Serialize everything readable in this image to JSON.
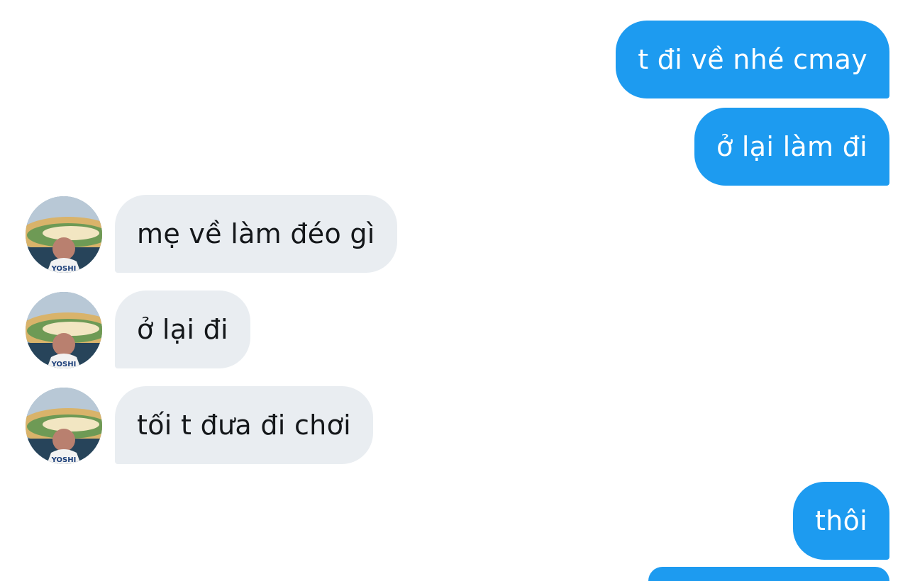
{
  "colors": {
    "outgoing_bubble": "#1d9bf0",
    "incoming_bubble": "#e9edf1",
    "outgoing_text": "#ffffff",
    "incoming_text": "#14171a"
  },
  "avatar": {
    "icon": "user-avatar-photo",
    "jersey_text": "YOSHI"
  },
  "messages": [
    {
      "direction": "outgoing",
      "text": "t đi về nhé cmay"
    },
    {
      "direction": "outgoing",
      "text": "ở lại làm đi"
    },
    {
      "direction": "incoming",
      "text": "mẹ về làm đéo gì"
    },
    {
      "direction": "incoming",
      "text": "ở lại đi"
    },
    {
      "direction": "incoming",
      "text": "tối t đưa đi chơi"
    },
    {
      "direction": "outgoing",
      "text": "thôi"
    }
  ]
}
